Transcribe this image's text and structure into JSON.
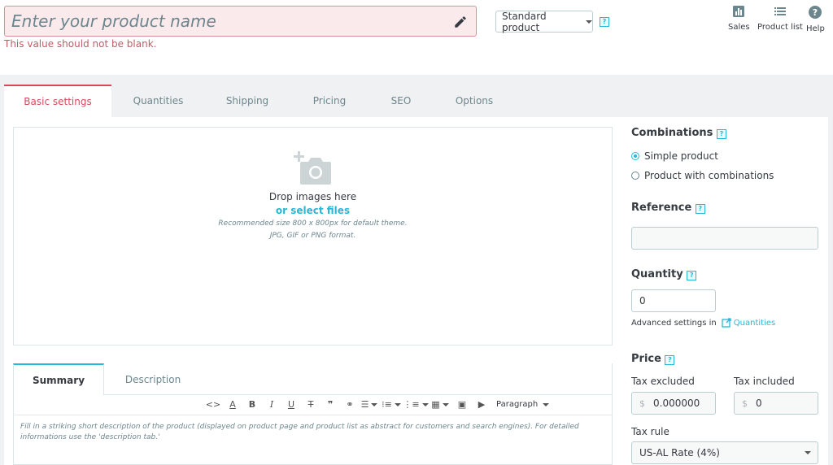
{
  "header": {
    "name_placeholder": "Enter your product name",
    "error": "This value should not be blank.",
    "product_type": "Standard product",
    "help_mark": "?",
    "buttons": [
      {
        "label": "Sales",
        "icon": "bar-chart-icon"
      },
      {
        "label": "Product list",
        "icon": "list-icon"
      },
      {
        "label": "Help",
        "icon": "help-circle-icon"
      }
    ]
  },
  "tabs": [
    "Basic settings",
    "Quantities",
    "Shipping",
    "Pricing",
    "SEO",
    "Options"
  ],
  "dropzone": {
    "title": "Drop images here",
    "link": "or select files",
    "hint1": "Recommended size 800 x 800px for default theme.",
    "hint2": "JPG, GIF or PNG format."
  },
  "description": {
    "tabs": [
      "Summary",
      "Description"
    ],
    "paragraph_select": "Paragraph",
    "text": "Fill in a striking short description of the product (displayed on product page and product list as abstract for customers and search engines). For detailed informations use the 'description tab.'"
  },
  "side": {
    "combinations_title": "Combinations",
    "option_simple": "Simple product",
    "option_combinations": "Product with combinations",
    "reference_title": "Reference",
    "reference_value": "",
    "quantity_title": "Quantity",
    "quantity_value": "0",
    "advanced_text": "Advanced settings in",
    "advanced_link": "Quantities",
    "price_title": "Price",
    "tax_excluded_label": "Tax excluded",
    "tax_included_label": "Tax included",
    "currency": "$",
    "tax_excluded_value": "0.000000",
    "tax_included_value": "0",
    "tax_rule_label": "Tax rule",
    "tax_rule_value": "US-AL Rate (4%)"
  },
  "colors": {
    "accent": "#25b9d7",
    "error": "#d5495a"
  }
}
